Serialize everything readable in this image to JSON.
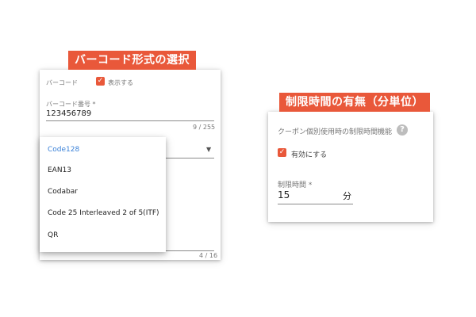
{
  "left": {
    "banner": "バーコード形式の選択",
    "barcode_label": "バーコード",
    "show_label": "表示する",
    "number_label": "バーコード番号 *",
    "number_value": "123456789",
    "number_counter": "9 / 255",
    "bottom_counter": "4 / 16",
    "options": [
      "Code128",
      "EAN13",
      "Codabar",
      "Code 25 Interleaved 2 of 5(ITF)",
      "QR"
    ],
    "selected_option": "Code128"
  },
  "right": {
    "banner": "制限時間の有無（分単位）",
    "feature_label": "クーポン個別使用時の制限時間機能",
    "enable_label": "有効にする",
    "time_label": "制限時間 *",
    "time_value": "15",
    "time_unit": "分"
  },
  "colors": {
    "accent": "#e9583a",
    "selected": "#3b82d8"
  }
}
